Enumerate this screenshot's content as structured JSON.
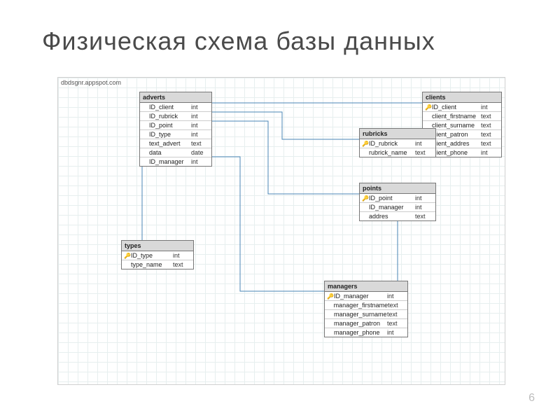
{
  "title": "Физическая схема базы данных",
  "canvas_label": "dbdsgnr.appspot.com",
  "page_number": "6",
  "tables": {
    "adverts": {
      "name": "adverts",
      "columns": [
        {
          "name": "ID_client",
          "type": "int",
          "pk": false
        },
        {
          "name": "ID_rubrick",
          "type": "int",
          "pk": false
        },
        {
          "name": "ID_point",
          "type": "int",
          "pk": false
        },
        {
          "name": "ID_type",
          "type": "int",
          "pk": false
        },
        {
          "name": "text_advert",
          "type": "text",
          "pk": false
        },
        {
          "name": "data",
          "type": "date",
          "pk": false
        },
        {
          "name": "ID_manager",
          "type": "int",
          "pk": false
        }
      ]
    },
    "clients": {
      "name": "clients",
      "columns": [
        {
          "name": "ID_client",
          "type": "int",
          "pk": true
        },
        {
          "name": "client_firstname",
          "type": "text",
          "pk": false
        },
        {
          "name": "client_surname",
          "type": "text",
          "pk": false
        },
        {
          "name": "client_patron",
          "type": "text",
          "pk": false
        },
        {
          "name": "client_addres",
          "type": "text",
          "pk": false
        },
        {
          "name": "client_phone",
          "type": "int",
          "pk": false
        }
      ]
    },
    "rubricks": {
      "name": "rubricks",
      "columns": [
        {
          "name": "ID_rubrick",
          "type": "int",
          "pk": true
        },
        {
          "name": "rubrick_name",
          "type": "text",
          "pk": false
        }
      ]
    },
    "points": {
      "name": "points",
      "columns": [
        {
          "name": "ID_point",
          "type": "int",
          "pk": true
        },
        {
          "name": "ID_manager",
          "type": "int",
          "pk": false
        },
        {
          "name": "addres",
          "type": "text",
          "pk": false
        }
      ]
    },
    "types": {
      "name": "types",
      "columns": [
        {
          "name": "ID_type",
          "type": "int",
          "pk": true
        },
        {
          "name": "type_name",
          "type": "text",
          "pk": false
        }
      ]
    },
    "managers": {
      "name": "managers",
      "columns": [
        {
          "name": "ID_manager",
          "type": "int",
          "pk": true
        },
        {
          "name": "manager_firstname",
          "type": "text",
          "pk": false
        },
        {
          "name": "manager_surname",
          "type": "text",
          "pk": false
        },
        {
          "name": "manager_patron",
          "type": "text",
          "pk": false
        },
        {
          "name": "manager_phone",
          "type": "int",
          "pk": false
        }
      ]
    }
  }
}
